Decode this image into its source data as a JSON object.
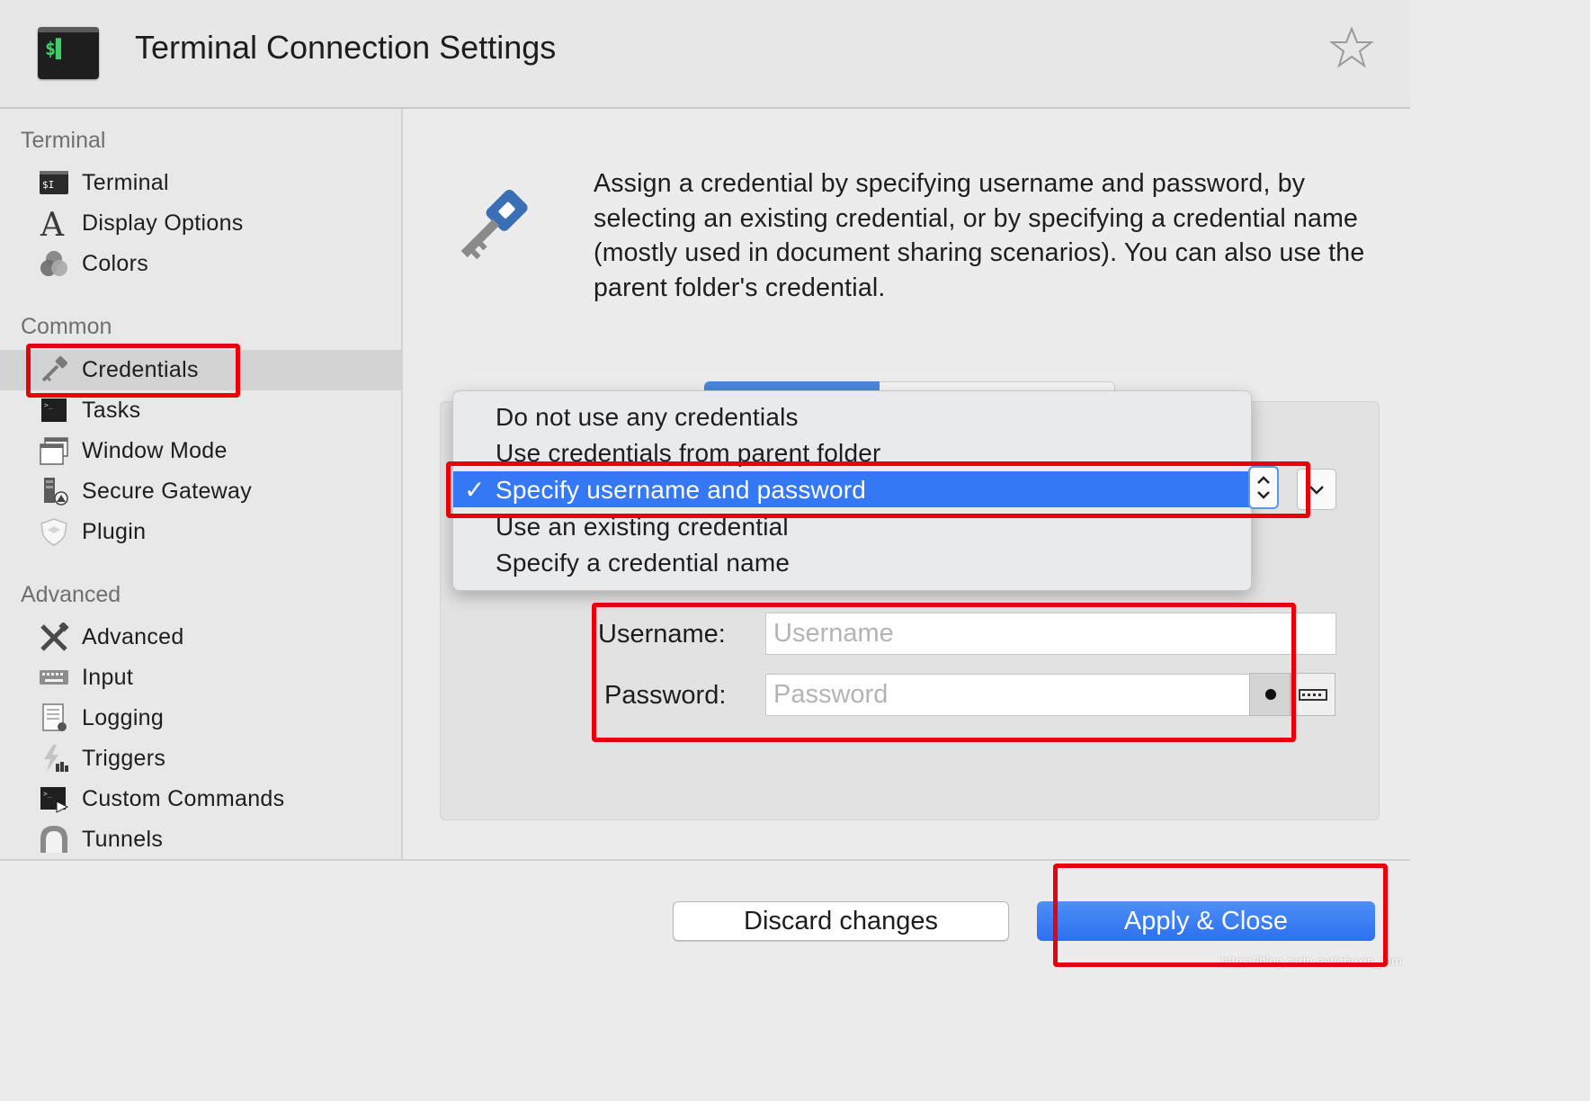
{
  "window": {
    "title": "Terminal Connection Settings",
    "app_icon_text": "$▌"
  },
  "sidebar": {
    "sections": [
      {
        "title": "Terminal",
        "items": [
          {
            "label": "Terminal",
            "icon": "terminal-icon"
          },
          {
            "label": "Display Options",
            "icon": "font-a-icon"
          },
          {
            "label": "Colors",
            "icon": "colors-icon"
          }
        ]
      },
      {
        "title": "Common",
        "items": [
          {
            "label": "Credentials",
            "icon": "key-icon",
            "selected": true
          },
          {
            "label": "Tasks",
            "icon": "tasks-icon"
          },
          {
            "label": "Window Mode",
            "icon": "window-mode-icon"
          },
          {
            "label": "Secure Gateway",
            "icon": "secure-gateway-icon"
          },
          {
            "label": "Plugin",
            "icon": "plugin-shield-icon"
          }
        ]
      },
      {
        "title": "Advanced",
        "items": [
          {
            "label": "Advanced",
            "icon": "tools-icon"
          },
          {
            "label": "Input",
            "icon": "keyboard-icon"
          },
          {
            "label": "Logging",
            "icon": "logging-icon"
          },
          {
            "label": "Triggers",
            "icon": "triggers-icon"
          },
          {
            "label": "Custom Commands",
            "icon": "custom-commands-icon"
          },
          {
            "label": "Tunnels",
            "icon": "tunnels-icon"
          }
        ]
      }
    ]
  },
  "main": {
    "description": "Assign a credential by specifying username and password, by selecting an existing credential, or by specifying a credential name (mostly used in document sharing scenarios). You can also use the parent folder's credential.",
    "credential_menu": {
      "options": [
        "Do not use any credentials",
        "Use credentials from parent folder",
        "Specify username and password",
        "Use an existing credential",
        "Specify a credential name"
      ],
      "selected": "Specify username and password",
      "check": "✓"
    },
    "form": {
      "username_label": "Username:",
      "username_placeholder": "Username",
      "username_value": "",
      "password_label": "Password:",
      "password_placeholder": "Password",
      "password_value": ""
    }
  },
  "footer": {
    "discard_label": "Discard changes",
    "apply_label": "Apply & Close",
    "watermark": "https://blog.csdn.net/chuxin_mm"
  },
  "colors": {
    "accent": "#3478f6",
    "annotation_red": "#e8000b",
    "terminal_green": "#3fd06b",
    "key_blue": "#3b6fb5"
  }
}
